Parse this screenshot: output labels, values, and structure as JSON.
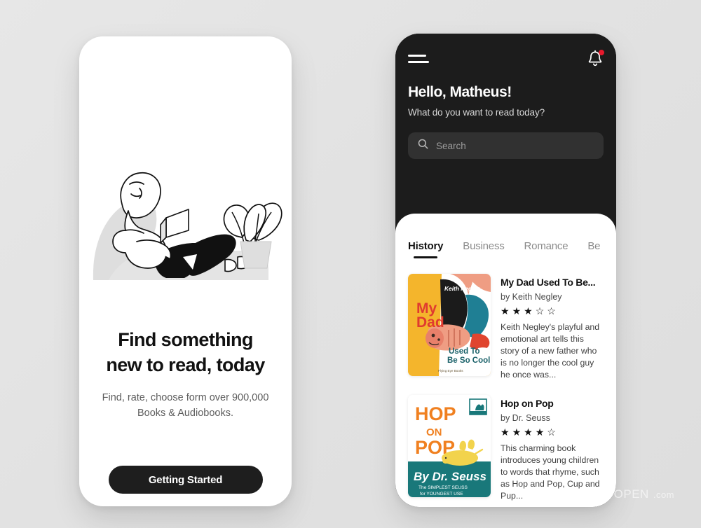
{
  "background_color": "#e4e4e4",
  "onboarding": {
    "illustration_name": "woman-reading-illustration",
    "heading_line1": "Find something",
    "heading_line2": "new to read, today",
    "subtitle": "Find, rate, choose form over 900,000 Books & Audiobooks.",
    "cta_label": "Getting Started",
    "cta_color": "#1e1e1e"
  },
  "home": {
    "header_color": "#1c1c1c",
    "menu_icon": "hamburger-menu-icon",
    "notification_icon": "bell-icon",
    "notification_badge_color": "#e8192c",
    "greeting": "Hello, Matheus!",
    "greeting_sub": "What do you want to read today?",
    "search": {
      "icon": "search-icon",
      "placeholder": "Search",
      "value": "",
      "background": "#313131"
    },
    "tabs": [
      {
        "label": "History",
        "active": true
      },
      {
        "label": "Business",
        "active": false
      },
      {
        "label": "Romance",
        "active": false
      },
      {
        "label": "Be",
        "active": false
      }
    ],
    "books": [
      {
        "title": "My Dad Used To Be...",
        "author": "by Keith Negley",
        "rating": 3,
        "rating_max": 5,
        "description": "Keith Negley's playful and emotional art tells this story of a new father who is no longer the cool guy he once was...",
        "cover": {
          "name": "my-dad-used-to-be-so-cool-cover",
          "background": "#f4b52c",
          "title_top": "My",
          "title_top2": "Dad",
          "title_bottom": "Used To",
          "title_bottom2": "Be So Cool",
          "author_credit": "Keith Negley",
          "publisher": "Flying Eye Books",
          "title_color": "#e03b2f",
          "subtitle_color": "#1a6169",
          "accent_teal": "#1f7f94",
          "accent_skin": "#ef9d83",
          "accent_red": "#e0452f"
        }
      },
      {
        "title": "Hop on Pop",
        "author": "by Dr. Seuss",
        "rating": 4,
        "rating_max": 5,
        "description": "This charming book introduces young children to words that rhyme, such as Hop and Pop, Cup and Pup...",
        "cover": {
          "name": "hop-on-pop-cover",
          "background": "#ffffff",
          "line1": "HOP",
          "line2": "ON",
          "line3": "POP",
          "byline": "By Dr. Seuss",
          "tagline1": "The SIMPLEST SEUSS",
          "tagline2": "for YOUNGEST USE",
          "title_color": "#f08020",
          "band_color": "#19787a",
          "dog_color": "#f2d34c"
        }
      }
    ]
  },
  "watermark": {
    "icon": "home-logo-icon",
    "text": "TOOOPEN",
    "domain": ".com"
  }
}
